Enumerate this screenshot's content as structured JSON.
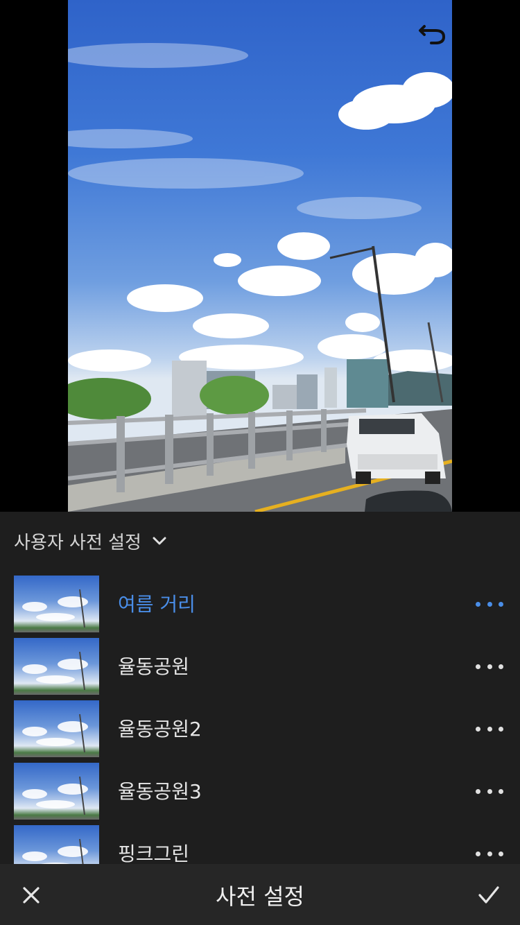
{
  "panel": {
    "group_title": "사용자 사전 설정",
    "presets": [
      {
        "name": "여름 거리",
        "selected": true
      },
      {
        "name": "율동공원",
        "selected": false
      },
      {
        "name": "율동공원2",
        "selected": false
      },
      {
        "name": "율동공원3",
        "selected": false
      },
      {
        "name": "핑크그린",
        "selected": false
      }
    ]
  },
  "bottom_bar": {
    "title": "사전 설정"
  },
  "icons": {
    "undo": "undo-icon",
    "help": "help-icon",
    "chevron": "chevron-down-icon",
    "more": "more-horizontal-icon",
    "cancel": "close-icon",
    "confirm": "checkmark-icon"
  },
  "colors": {
    "accent": "#4a8ee8",
    "panel_bg": "#1e1e1e",
    "bar_bg": "#262626",
    "text": "#e6e6e6"
  }
}
